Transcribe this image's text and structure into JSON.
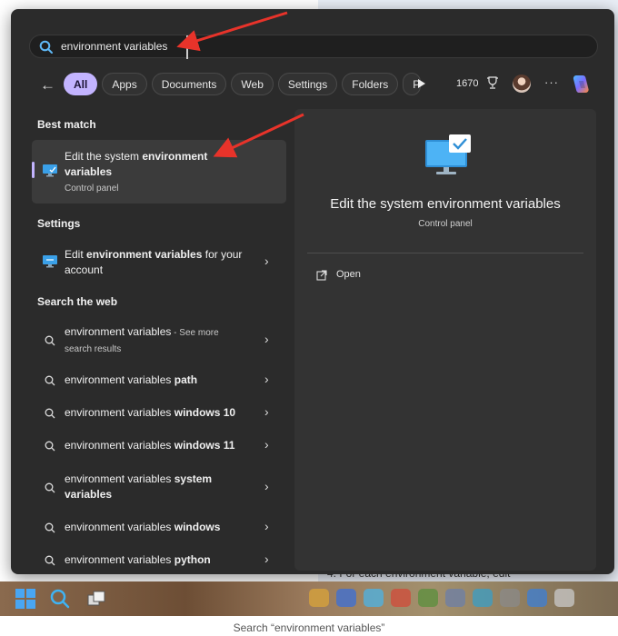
{
  "search": {
    "value": "environment variables",
    "placeholder": ""
  },
  "filters": {
    "back_label": "←",
    "chips": [
      "All",
      "Apps",
      "Documents",
      "Web",
      "Settings",
      "Folders",
      "P"
    ],
    "active": "All",
    "points": "1670",
    "more_label": "···"
  },
  "best_match": {
    "heading": "Best match",
    "title_prefix": "Edit the system ",
    "title_bold": "environment variables",
    "subtitle": "Control panel"
  },
  "settings": {
    "heading": "Settings",
    "item_prefix": "Edit ",
    "item_bold": "environment variables",
    "item_suffix": " for your account"
  },
  "web": {
    "heading": "Search the web",
    "items": [
      {
        "base": "environment variables",
        "bold": "",
        "extra": " - See more",
        "sub": "search results"
      },
      {
        "base": "environment variables ",
        "bold": "path",
        "extra": "",
        "sub": ""
      },
      {
        "base": "environment variables ",
        "bold": "windows 10",
        "extra": "",
        "sub": ""
      },
      {
        "base": "environment variables ",
        "bold": "windows 11",
        "extra": "",
        "sub": ""
      },
      {
        "base": "environment variables ",
        "bold": "system variables",
        "extra": "",
        "sub": ""
      },
      {
        "base": "environment variables ",
        "bold": "windows",
        "extra": "",
        "sub": ""
      },
      {
        "base": "environment variables ",
        "bold": "python",
        "extra": "",
        "sub": ""
      }
    ]
  },
  "detail": {
    "title": "Edit the system environment variables",
    "subtitle": "Control panel",
    "action_open": "Open"
  },
  "background": {
    "footer_text": "4. For each environment variable, edit"
  },
  "caption": "Search “environment variables”",
  "colors": {
    "panel": "#2b2b2b",
    "accent": "#c3b4ff",
    "annotation": "#e8332a"
  },
  "icons": [
    "search-icon",
    "monitor-icon",
    "chevron-right-icon",
    "trophy-icon",
    "copilot-icon",
    "open-window-icon",
    "windows-logo-icon",
    "task-view-icon",
    "play-icon"
  ]
}
